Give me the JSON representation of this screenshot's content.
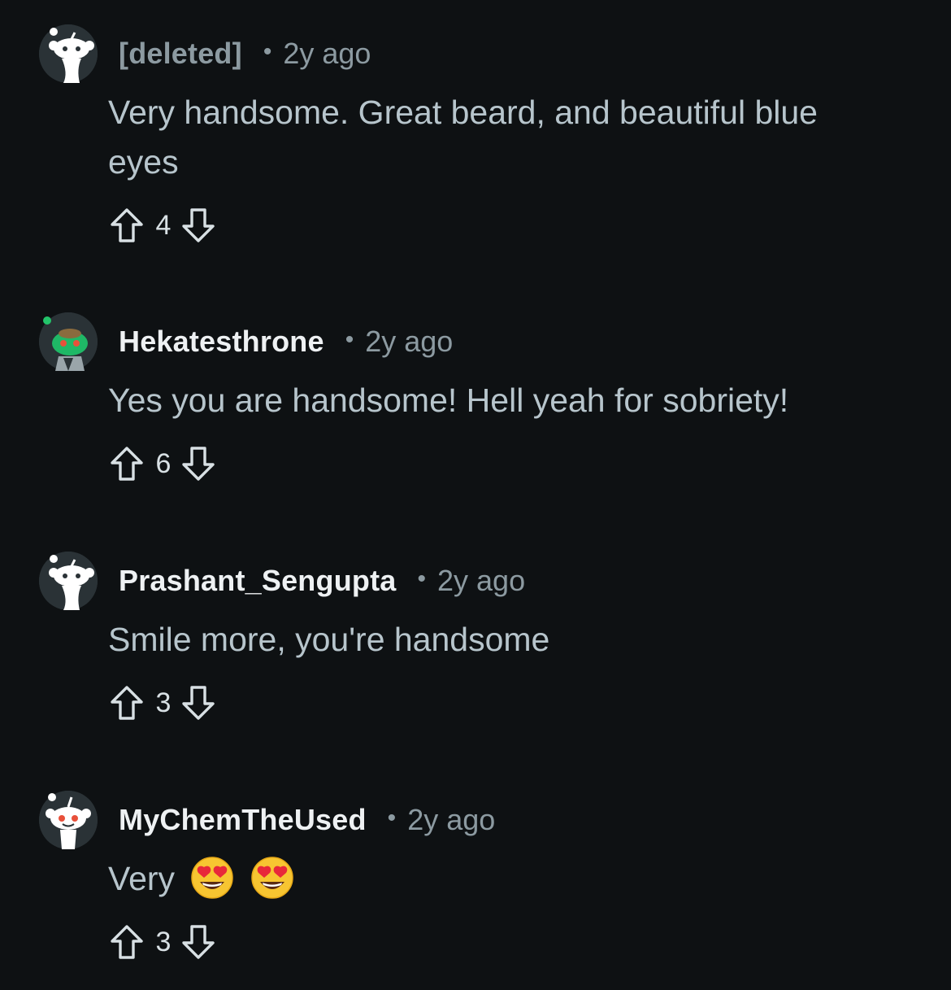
{
  "comments": [
    {
      "username": "[deleted]",
      "separator": "•",
      "age": "2y ago",
      "body": "Very handsome. Great beard, and beautiful blue eyes",
      "score": "4",
      "avatar_icon": "snoo-default-avatar-icon"
    },
    {
      "username": "Hekatesthrone",
      "separator": "•",
      "age": "2y ago",
      "body": "Yes you are handsome! Hell yeah for sobriety!",
      "score": "6",
      "avatar_icon": "snoo-green-avatar-icon"
    },
    {
      "username": "Prashant_Sengupta",
      "separator": "•",
      "age": "2y ago",
      "body": "Smile more, you're handsome",
      "score": "3",
      "avatar_icon": "snoo-default-avatar-icon"
    },
    {
      "username": "MyChemTheUsed",
      "separator": "•",
      "age": "2y ago",
      "body": "Very",
      "body_emojis": [
        "heart-eyes-emoji",
        "heart-eyes-emoji"
      ],
      "score": "3",
      "avatar_icon": "snoo-face-avatar-icon"
    }
  ],
  "colors": {
    "background": "#0e1113",
    "username": "#eef1f3",
    "meta": "#8c9aa1",
    "body": "#b7c5cc"
  }
}
